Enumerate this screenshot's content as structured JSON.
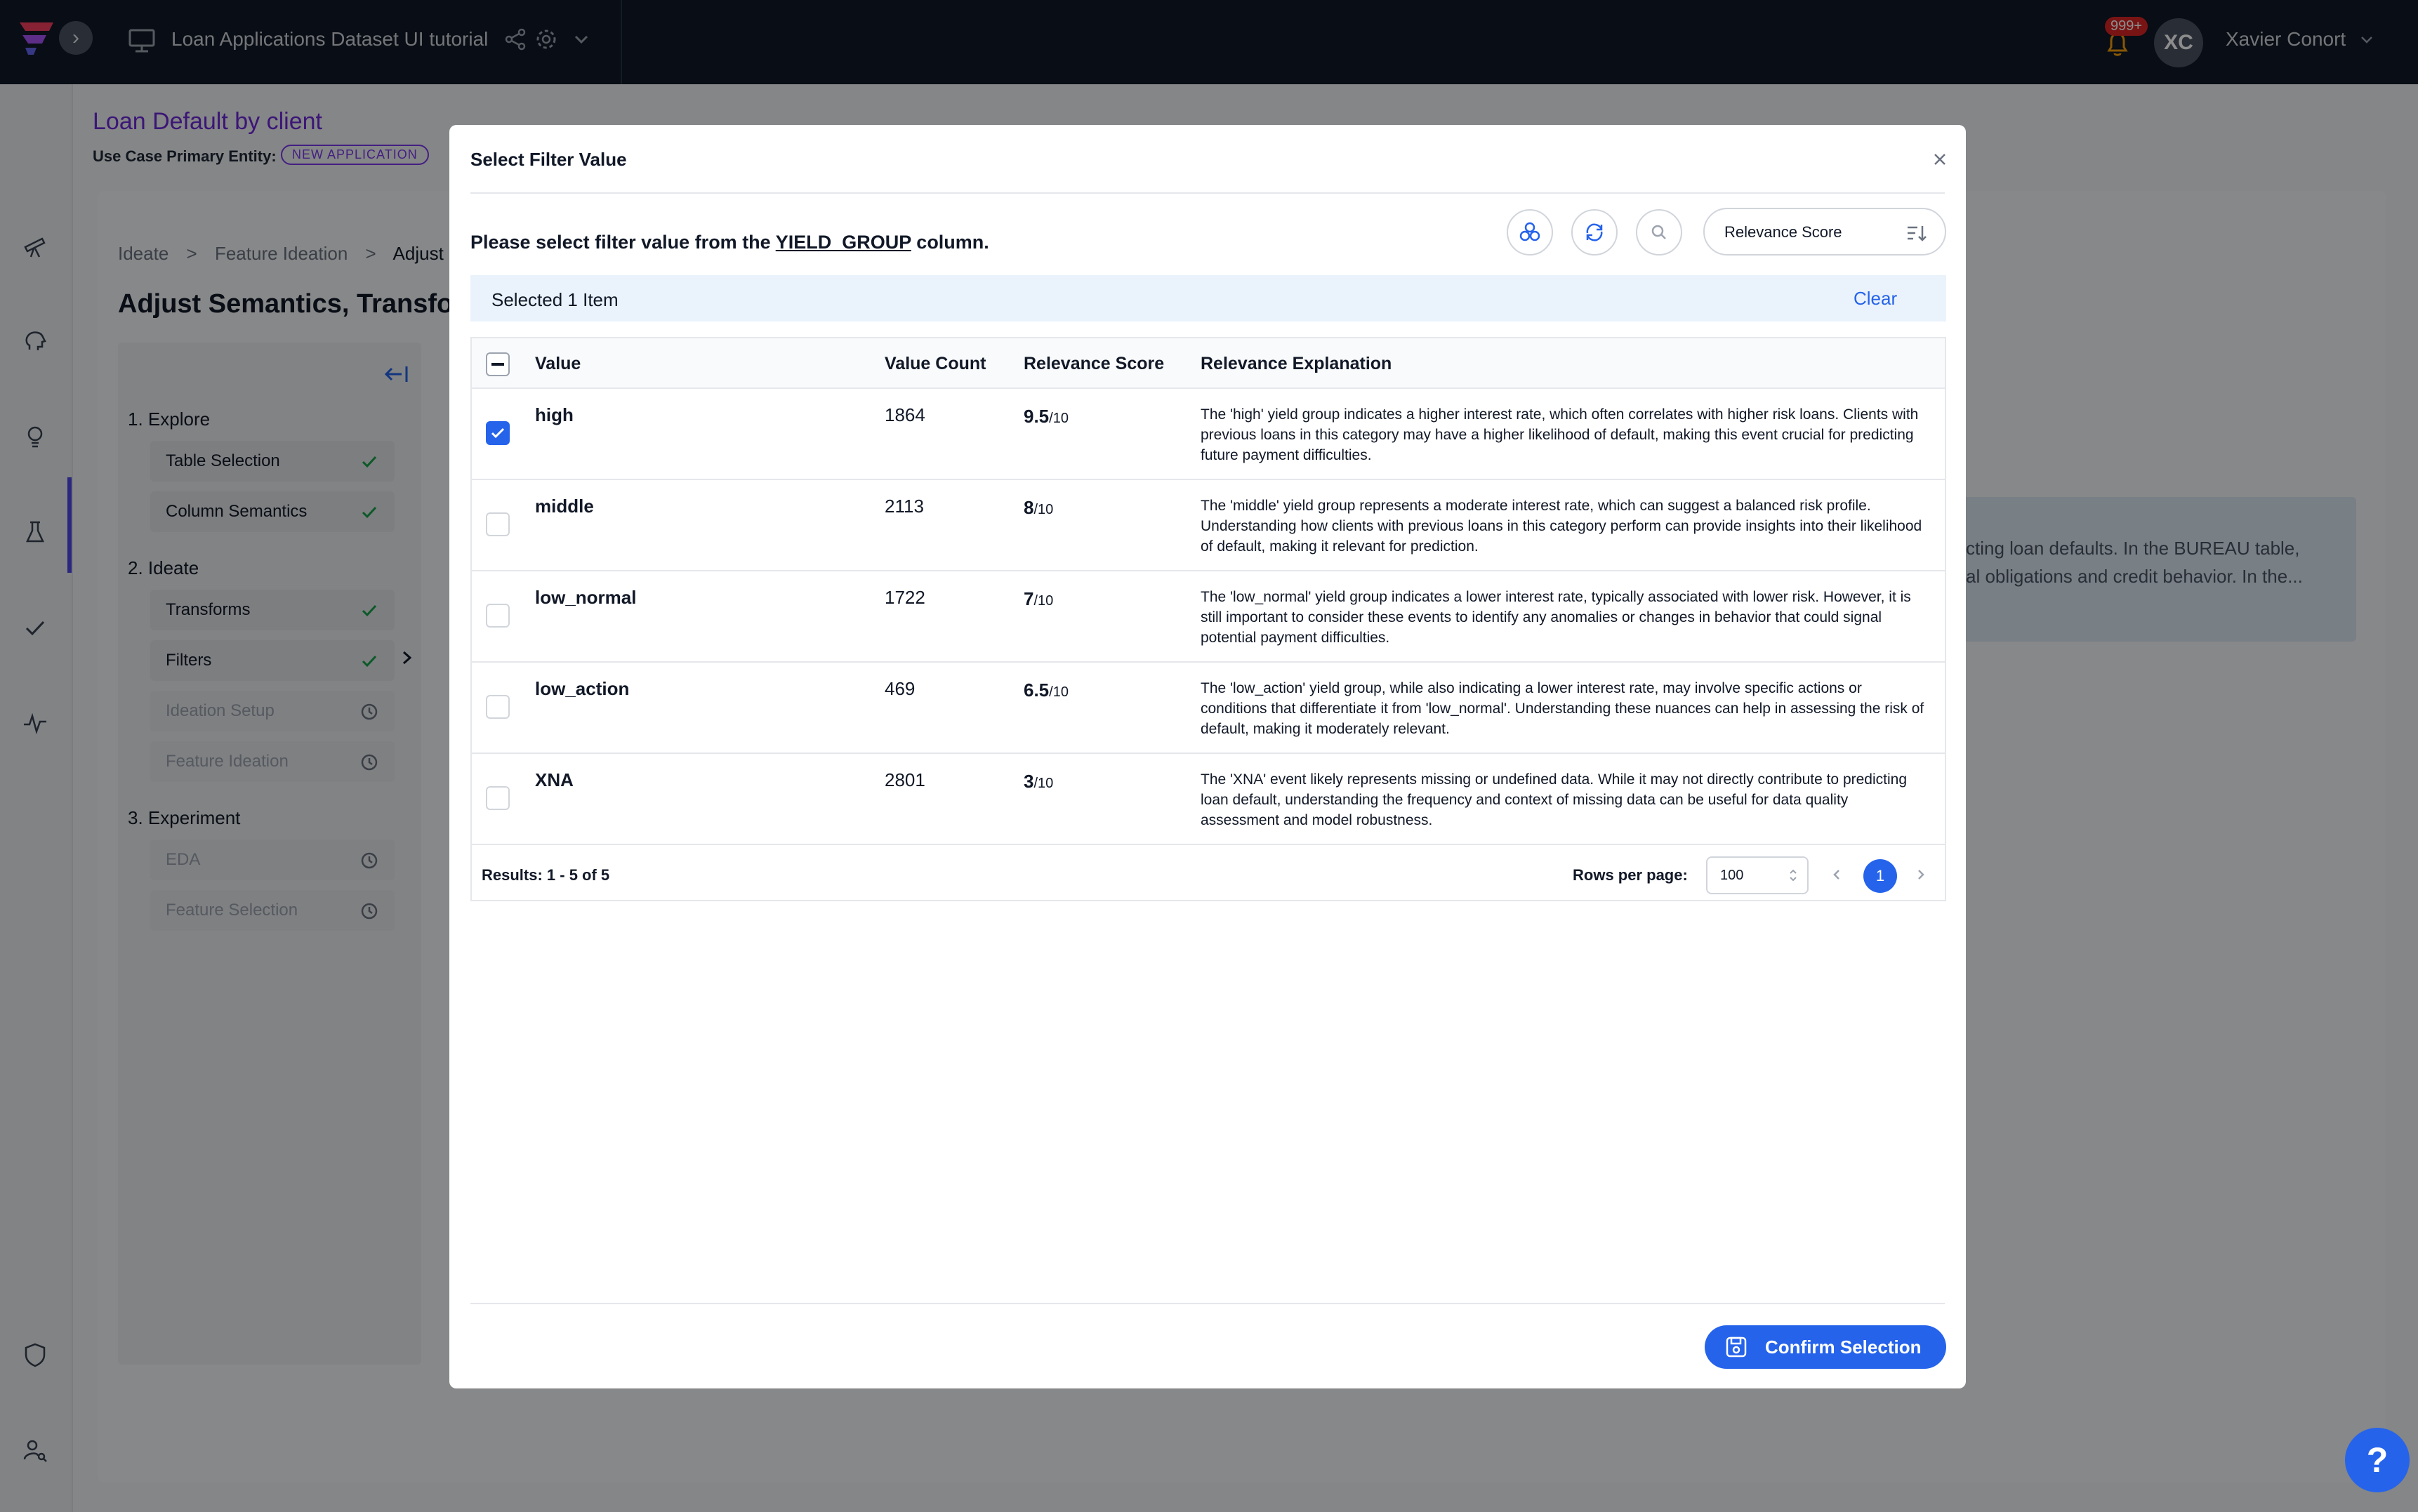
{
  "topbar": {
    "project_title": "Loan Applications Dataset UI tutorial",
    "notification_count": "999+",
    "user_initials": "XC",
    "user_name": "Xavier Conort"
  },
  "use_case": {
    "title": "Loan Default by client",
    "entity_label": "Use Case Primary Entity:",
    "entity_badge": "NEW APPLICATION"
  },
  "breadcrumb": [
    "Ideate",
    ">",
    "Feature Ideation",
    ">",
    "Adjust S"
  ],
  "page_title": "Adjust Semantics, Transfor",
  "steps": {
    "explore": "1. Explore",
    "table_selection": "Table Selection",
    "column_semantics": "Column Semantics",
    "ideate": "2. Ideate",
    "transforms": "Transforms",
    "filters": "Filters",
    "ideation_setup": "Ideation Setup",
    "feature_ideation": "Feature Ideation",
    "experiment": "3. Experiment",
    "eda": "EDA",
    "feature_selection": "Feature Selection"
  },
  "background_right": {
    "line1": "cting loan defaults. In the BUREAU table,",
    "line2": "al obligations and credit behavior. In the..."
  },
  "modal": {
    "title": "Select Filter Value",
    "prompt_prefix": "Please select filter value from the",
    "prompt_column": "YIELD_GROUP",
    "prompt_suffix": "column.",
    "sort_label": "Relevance Score",
    "selected_text": "Selected 1 Item",
    "clear_label": "Clear",
    "columns": {
      "value": "Value",
      "count": "Value Count",
      "score": "Relevance Score",
      "explanation": "Relevance Explanation"
    },
    "rows": [
      {
        "value": "high",
        "count": "1864",
        "score": "9.5",
        "den": "/10",
        "checked": true,
        "explanation": "The 'high' yield group indicates a higher interest rate, which often correlates with higher risk loans. Clients with previous loans in this category may have a higher likelihood of default, making this event crucial for predicting future payment difficulties."
      },
      {
        "value": "middle",
        "count": "2113",
        "score": "8",
        "den": "/10",
        "checked": false,
        "explanation": "The 'middle' yield group represents a moderate interest rate, which can suggest a balanced risk profile. Understanding how clients with previous loans in this category perform can provide insights into their likelihood of default, making it relevant for prediction."
      },
      {
        "value": "low_normal",
        "count": "1722",
        "score": "7",
        "den": "/10",
        "checked": false,
        "explanation": "The 'low_normal' yield group indicates a lower interest rate, typically associated with lower risk. However, it is still important to consider these events to identify any anomalies or changes in behavior that could signal potential payment difficulties."
      },
      {
        "value": "low_action",
        "count": "469",
        "score": "6.5",
        "den": "/10",
        "checked": false,
        "explanation": "The 'low_action' yield group, while also indicating a lower interest rate, may involve specific actions or conditions that differentiate it from 'low_normal'. Understanding these nuances can help in assessing the risk of default, making it moderately relevant."
      },
      {
        "value": "XNA",
        "count": "2801",
        "score": "3",
        "den": "/10",
        "checked": false,
        "explanation": "The 'XNA' event likely represents missing or undefined data. While it may not directly contribute to predicting loan default, understanding the frequency and context of missing data can be useful for data quality assessment and model robustness."
      }
    ],
    "results_text": "Results: 1 - 5 of 5",
    "rows_per_page_label": "Rows per page:",
    "rows_per_page_value": "100",
    "current_page": "1",
    "confirm_label": "Confirm Selection"
  },
  "help_label": "?",
  "colors": {
    "accent": "#2563eb",
    "brand_purple": "#6d28d9",
    "topbar_bg": "#111827"
  },
  "icons": [
    "logo-icon",
    "monitor-icon",
    "share-icon",
    "gear-icon",
    "chevron-down-icon",
    "bell-icon",
    "close-icon",
    "group-icon",
    "refresh-icon",
    "search-icon",
    "sort-icon",
    "check-icon",
    "clock-icon",
    "save-icon"
  ]
}
